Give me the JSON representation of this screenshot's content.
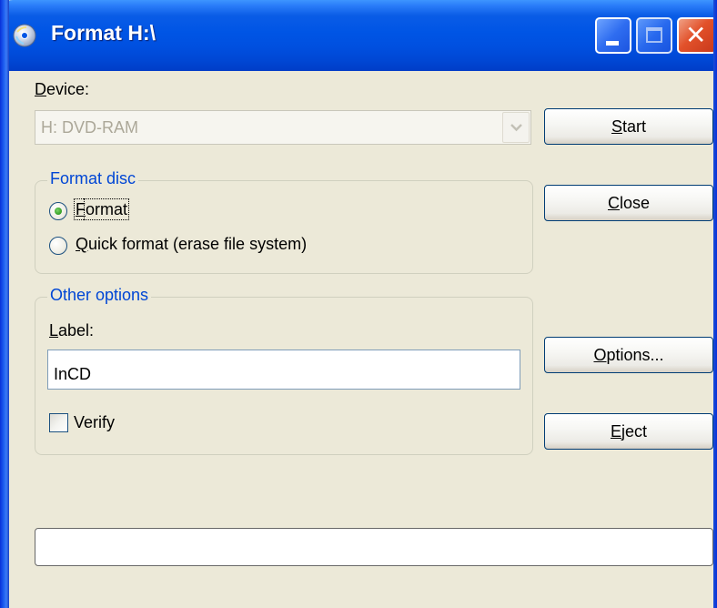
{
  "window": {
    "title": "Format H:\\",
    "accent": "#0055e5",
    "close_color": "#e2512a"
  },
  "device": {
    "label_prefix": "",
    "label_key": "D",
    "label_rest": "evice:",
    "selected": "H: DVD-RAM"
  },
  "buttons": {
    "start": {
      "key": "S",
      "rest": "tart"
    },
    "close": {
      "key": "C",
      "rest": "lose"
    },
    "options": {
      "key": "O",
      "rest": "ptions..."
    },
    "eject": {
      "key": "E",
      "rest": "ject"
    }
  },
  "format_disc": {
    "legend": "Format disc",
    "options": [
      {
        "key": "F",
        "rest": "ormat",
        "selected": true
      },
      {
        "key": "Q",
        "rest": "uick format (erase file system)",
        "selected": false
      }
    ]
  },
  "other_options": {
    "legend": "Other options",
    "label_key": "L",
    "label_rest": "abel:",
    "label_value": "InCD",
    "verify_label": "Verify",
    "verify_checked": false
  },
  "progress": {
    "fraction": 0
  }
}
